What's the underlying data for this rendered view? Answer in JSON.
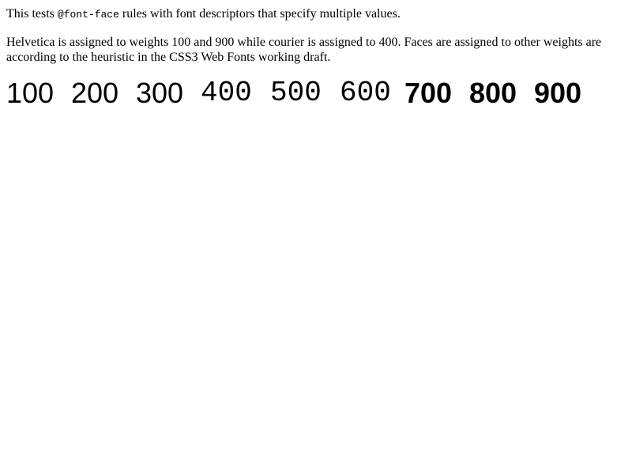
{
  "intro": {
    "prefix": "This tests ",
    "code": "@font-face",
    "suffix": " rules with font descriptors that specify multiple values."
  },
  "description": "Helvetica is assigned to weights 100 and 900 while courier is assigned to 400. Faces are assigned to other weights are according to the heuristic in the CSS3 Web Fonts working draft.",
  "weights": {
    "w100": "100",
    "w200": "200",
    "w300": "300",
    "w400": "400",
    "w500": "500",
    "w600": "600",
    "w700": "700",
    "w800": "800",
    "w900": "900"
  },
  "colors": {
    "text": "#000000",
    "background": "#ffffff"
  }
}
